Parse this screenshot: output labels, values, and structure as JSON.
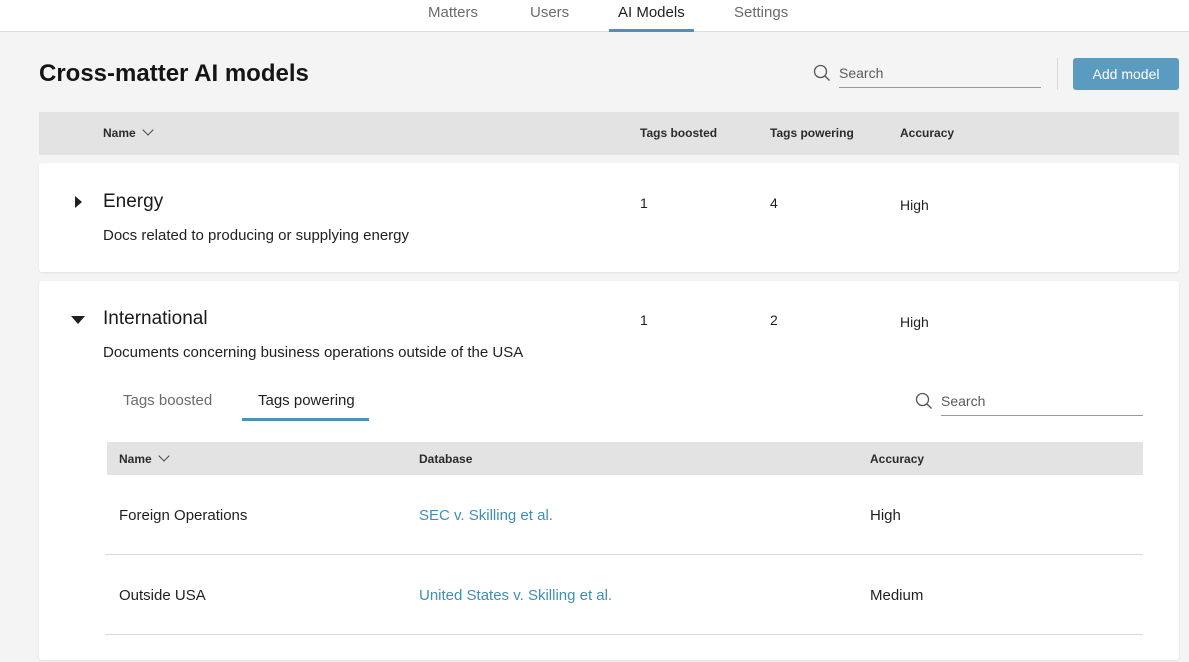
{
  "nav": {
    "tabs": [
      {
        "label": "Matters"
      },
      {
        "label": "Users"
      },
      {
        "label": "AI Models"
      },
      {
        "label": "Settings"
      }
    ],
    "active": "AI Models"
  },
  "header": {
    "title": "Cross-matter AI models",
    "search_placeholder": "Search",
    "add_button": "Add model"
  },
  "table": {
    "columns": {
      "name": "Name",
      "tags_boosted": "Tags boosted",
      "tags_powering": "Tags powering",
      "accuracy": "Accuracy"
    }
  },
  "models": [
    {
      "name": "Energy",
      "description": "Docs related to producing or supplying energy",
      "tags_boosted": "1",
      "tags_powering": "4",
      "accuracy": "High",
      "expanded": false
    },
    {
      "name": "International",
      "description": "Documents concerning business operations outside of the USA",
      "tags_boosted": "1",
      "tags_powering": "2",
      "accuracy": "High",
      "expanded": true,
      "subtabs": [
        "Tags boosted",
        "Tags powering"
      ],
      "active_subtab": "Tags powering",
      "search_placeholder": "Search",
      "inner_columns": {
        "name": "Name",
        "database": "Database",
        "accuracy": "Accuracy"
      },
      "rows": [
        {
          "name": "Foreign Operations",
          "database": "SEC v. Skilling et al.",
          "accuracy": "High"
        },
        {
          "name": "Outside USA",
          "database": "United States v. Skilling et al.",
          "accuracy": "Medium"
        }
      ]
    }
  ],
  "colors": {
    "accent": "#4a93b8",
    "button": "#5a9cc0",
    "link": "#3e8fb5",
    "background": "#f4f4f4"
  }
}
